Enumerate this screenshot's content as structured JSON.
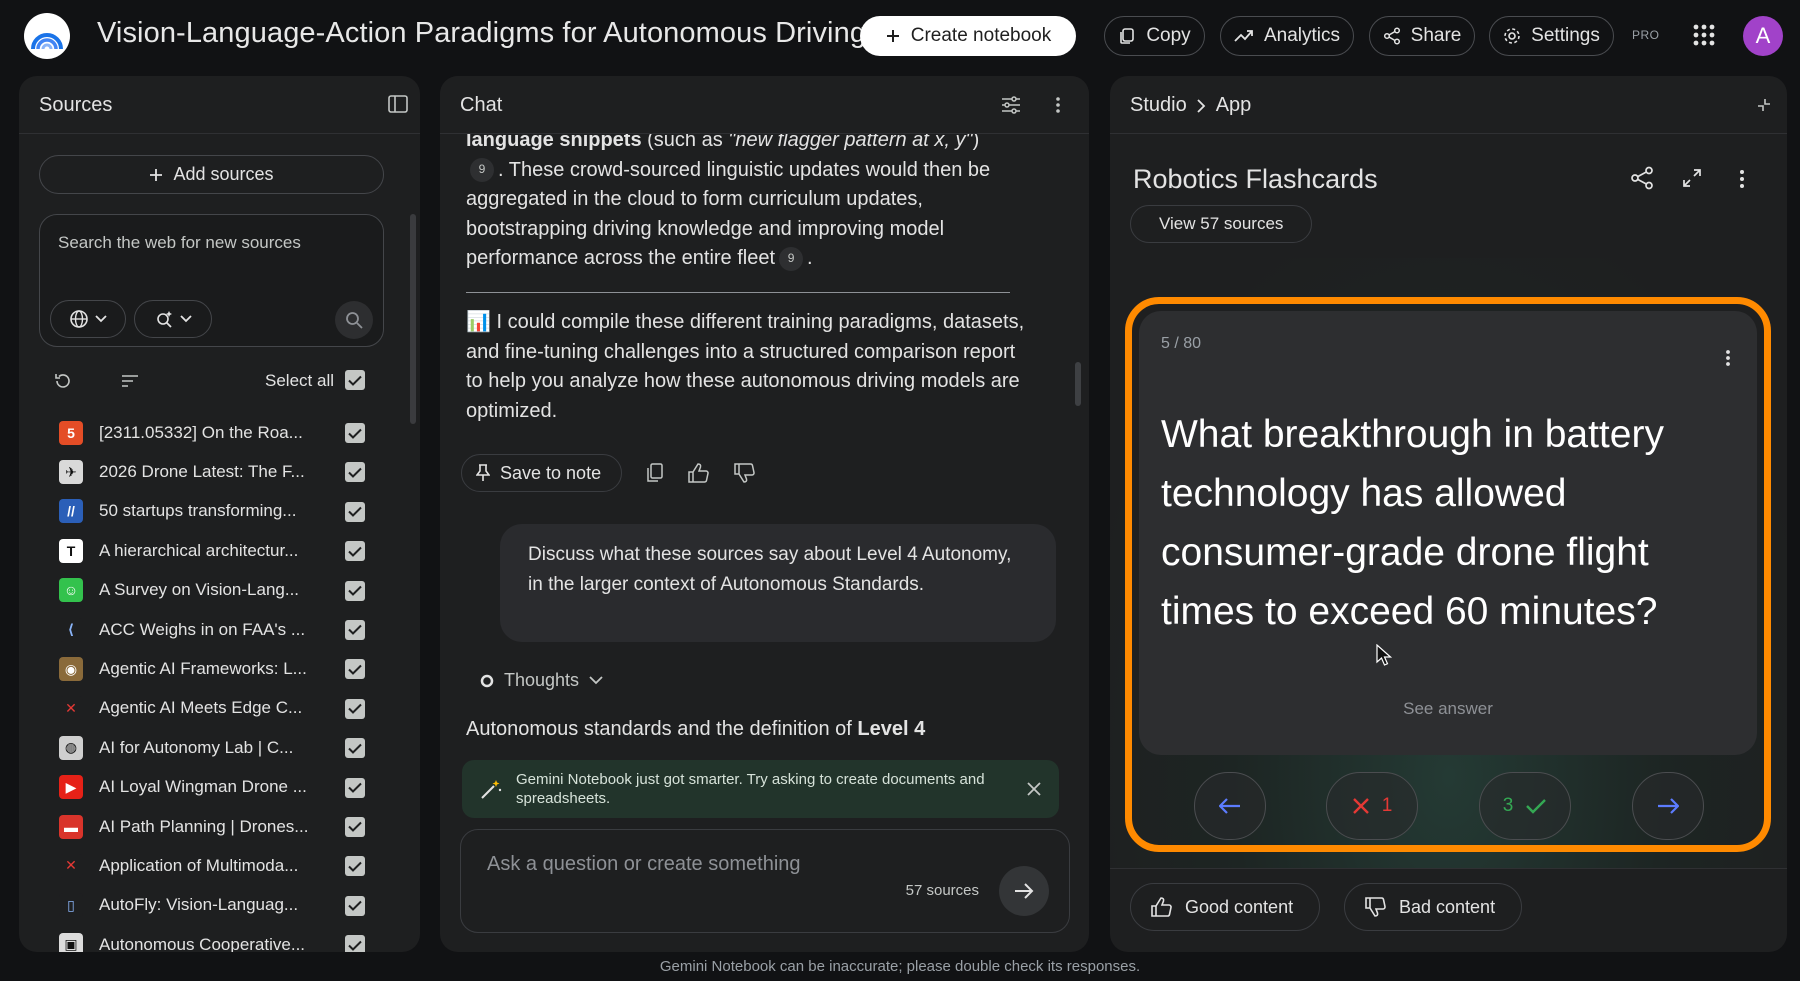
{
  "app": {
    "title": "Vision-Language-Action Paradigms for Autonomous Driving",
    "avatar_letter": "A",
    "pro_badge": "PRO"
  },
  "topbar": {
    "create_notebook": "Create notebook",
    "copy": "Copy",
    "analytics": "Analytics",
    "share": "Share",
    "settings": "Settings"
  },
  "sources": {
    "title": "Sources",
    "add_sources": "Add sources",
    "search_placeholder": "Search the web for new sources",
    "select_all": "Select all",
    "items": [
      {
        "label": "[2311.05332] On the Roa...",
        "icon_bg": "#e44d26",
        "icon_text": "5"
      },
      {
        "label": "2026 Drone Latest: The F...",
        "icon_bg": "#d9d9d9",
        "icon_text": "✈"
      },
      {
        "label": "50 startups transforming...",
        "icon_bg": "#2b5fb8",
        "icon_text": "//"
      },
      {
        "label": "A hierarchical architectur...",
        "icon_bg": "#ffffff",
        "icon_text": "T"
      },
      {
        "label": "A Survey on Vision-Lang...",
        "icon_bg": "#33c24d",
        "icon_text": "☺"
      },
      {
        "label": "ACC Weighs in on FAA's ...",
        "icon_bg": "#1e1f20",
        "icon_text": "⟨"
      },
      {
        "label": "Agentic AI Frameworks: L...",
        "icon_bg": "#8a6a3a",
        "icon_text": "◉"
      },
      {
        "label": "Agentic AI Meets Edge C...",
        "icon_bg": "#1e1f20",
        "icon_text": "✕"
      },
      {
        "label": "AI for Autonomy Lab | C...",
        "icon_bg": "#cfcfcf",
        "icon_text": "◍"
      },
      {
        "label": "AI Loyal Wingman Drone ...",
        "icon_bg": "#e62117",
        "icon_text": "▶"
      },
      {
        "label": "AI Path Planning | Drones...",
        "icon_bg": "#d9342b",
        "icon_text": "▬"
      },
      {
        "label": "Application of Multimoda...",
        "icon_bg": "#1e1f20",
        "icon_text": "✕"
      },
      {
        "label": "AutoFly: Vision-Languag...",
        "icon_bg": "#1e1f20",
        "icon_text": "▯"
      },
      {
        "label": "Autonomous Cooperative...",
        "icon_bg": "#dcdcdc",
        "icon_text": "▣"
      }
    ]
  },
  "chat": {
    "title": "Chat",
    "p1_bold": "language snippets",
    "p1_a": " (such as ",
    "p1_italic": "\"new flagger pattern at x, y\"",
    "p1_b": ")",
    "p1_c": ". These crowd-sourced linguistic updates would then be aggregated in the cloud to form curriculum updates, bootstrapping driving knowledge and improving model performance across the entire fleet",
    "p1_end": ".",
    "cite": "9",
    "p2": "📊 I could compile these different training paradigms, datasets, and fine-tuning challenges into a structured comparison report to help you analyze how these autonomous driving models are optimized.",
    "save_to_note": "Save to note",
    "user_message": "Discuss what these sources say about Level 4 Autonomy, in the larger context of Autonomous Standards.",
    "thoughts": "Thoughts",
    "resp_start": "Autonomous standards and the definition of ",
    "resp_bold": "Level 4",
    "tip": "Gemini Notebook just got smarter. Try asking to create documents and spreadsheets.",
    "ask_placeholder": "Ask a question or create something",
    "source_count": "57 sources"
  },
  "studio": {
    "crumb_root": "Studio",
    "crumb_leaf": "App",
    "title": "Robotics Flashcards",
    "view_sources": "View 57 sources",
    "card_counter": "5 / 80",
    "question": "What breakthrough in battery technology has allowed consumer-grade drone flight times to exceed 60 minutes?",
    "see_answer": "See answer",
    "wrong_count": "1",
    "right_count": "3",
    "good_content": "Good content",
    "bad_content": "Bad content"
  },
  "footer": "Gemini Notebook can be inaccurate; please double check its responses.",
  "colors": {
    "accent_orange": "#ff8a00",
    "arrow_blue": "#5c7cff",
    "wrong_red": "#e53935",
    "right_green": "#34a853"
  }
}
